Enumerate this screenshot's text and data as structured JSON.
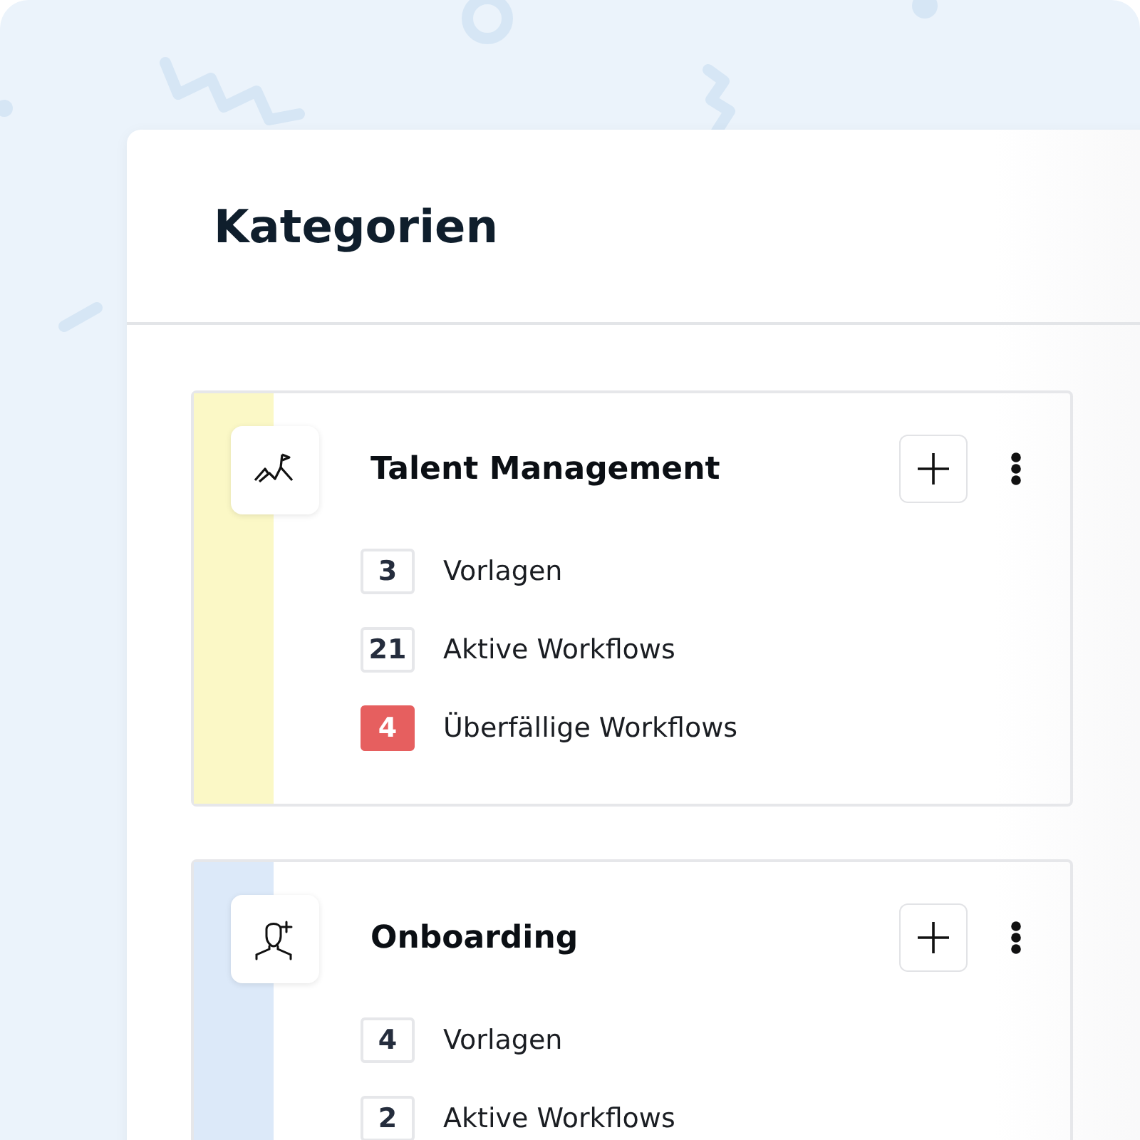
{
  "title": "Kategorien",
  "categories": [
    {
      "name": "Talent Management",
      "kind": "goal",
      "color": "#fbf8c6",
      "stats": [
        {
          "count": "3",
          "label": "Vorlagen",
          "kind": "normal"
        },
        {
          "count": "21",
          "label": "Aktive Workflows",
          "kind": "normal"
        },
        {
          "count": "4",
          "label": "Überfällige Workflows",
          "kind": "overdue"
        }
      ]
    },
    {
      "name": "Onboarding",
      "kind": "onboarding",
      "color": "#dce9f9",
      "stats": [
        {
          "count": "4",
          "label": "Vorlagen",
          "kind": "normal"
        },
        {
          "count": "2",
          "label": "Aktive Workflows",
          "kind": "normal"
        }
      ]
    }
  ]
}
